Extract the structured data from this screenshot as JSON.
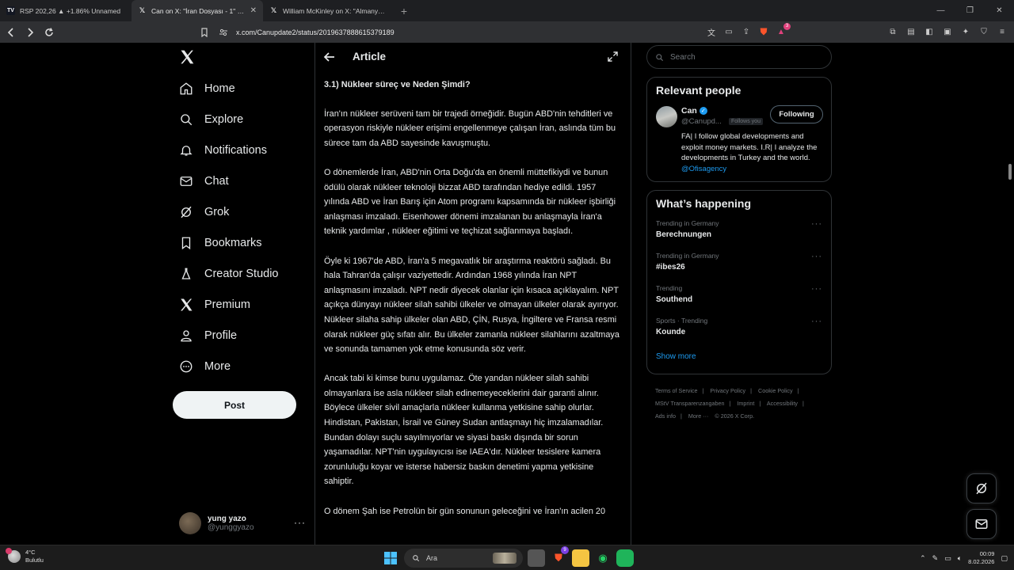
{
  "browser": {
    "tabs": [
      {
        "title": "RSP 202,26 ▲ +1.86% Unnamed",
        "favicon": "TV",
        "active": false
      },
      {
        "title": "Can on X: \"İran Dosyası - 1\" / X",
        "favicon": "X",
        "active": true
      },
      {
        "title": "William McKinley on X: \"Almanya'da",
        "favicon": "X",
        "active": false
      }
    ],
    "url": "x.com/Canupdate2/status/2019637888615379189",
    "brave_badge": "3"
  },
  "nav": {
    "items": [
      {
        "label": "Home",
        "icon": "home-icon"
      },
      {
        "label": "Explore",
        "icon": "search-icon"
      },
      {
        "label": "Notifications",
        "icon": "bell-icon"
      },
      {
        "label": "Chat",
        "icon": "mail-icon"
      },
      {
        "label": "Grok",
        "icon": "grok-icon"
      },
      {
        "label": "Bookmarks",
        "icon": "bookmark-icon"
      },
      {
        "label": "Creator Studio",
        "icon": "flask-icon"
      },
      {
        "label": "Premium",
        "icon": "x-icon"
      },
      {
        "label": "Profile",
        "icon": "person-icon"
      },
      {
        "label": "More",
        "icon": "more-circle-icon"
      }
    ],
    "post_label": "Post",
    "me": {
      "display_name": "yung yazo",
      "handle": "@yunggyazo"
    }
  },
  "article": {
    "header_title": "Article",
    "heading": "3.1) Nükleer süreç ve Neden Şimdi?",
    "paragraphs": [
      "İran'ın nükleer serüveni tam bir trajedi örneğidir. Bugün ABD'nin tehditleri ve  operasyon riskiyle  nükleer erişimi engellenmeye çalışan İran, aslında tüm bu sürece tam da ABD sayesinde kavuşmuştu.",
      "O dönemlerde İran, ABD'nin Orta Doğu'da en önemli müttefikiydi ve bunun ödülü olarak nükleer teknoloji bizzat ABD tarafından hediye edildi. 1957 yılında ABD ve İran Barış için Atom programı kapsamında bir nükleer işbirliği anlaşması imzaladı. Eisenhower dönemi imzalanan bu anlaşmayla İran'a teknik yardımlar , nükleer eğitimi ve teçhizat sağlanmaya başladı.",
      "Öyle ki 1967'de ABD, İran'a 5 megavatlık bir araştırma reaktörü sağladı. Bu hala  Tahran'da çalışır vaziyettedir. Ardından 1968 yılında İran  NPT anlaşmasını imzaladı. NPT nedir diyecek olanlar için kısaca açıklayalım. NPT açıkça dünyayı nükleer silah sahibi ülkeler ve olmayan ülkeler olarak ayırıyor. Nükleer silaha sahip ülkeler olan ABD, ÇİN, Rusya, İngiltere ve Fransa resmi olarak nükleer güç sıfatı alır. Bu ülkeler zamanla nükleer silahlarını azaltmaya ve sonunda tamamen yok etme konusunda söz verir.",
      "Ancak tabi ki kimse bunu uygulamaz. Öte yandan nükleer silah sahibi olmayanlara ise asla nükleer silah edinemeyeceklerini  dair garanti alınır. Böylece  ülkeler sivil amaçlarla nükleer kullanma yetkisine sahip olurlar. Hindistan, Pakistan, İsrail ve Güney Sudan antlaşmayı hiç imzalamadılar. Bundan dolayı suçlu sayılmıyorlar ve siyasi baskı dışında bir sorun yaşamadılar. NPT'nin uygulayıcısı ise IAEA'dır.  Nükleer tesislere kamera zorunluluğu koyar ve  isterse habersiz baskın denetimi yapma yetkisine sahiptir.",
      "O dönem Şah ise Petrolün bir gün sonunun geleceğini ve İran'ın acilen 20"
    ]
  },
  "search": {
    "placeholder": "Search"
  },
  "relevant": {
    "title": "Relevant people",
    "name": "Can",
    "handle": "@Canupd...",
    "follows_you": "Follows you",
    "follow_label": "Following",
    "bio": "FA| I follow global developments and exploit money markets. I.R| I analyze the developments in Turkey and the world.",
    "bio_link": "@Ofisagency"
  },
  "happening": {
    "title": "What’s happening",
    "trends": [
      {
        "context": "Trending in Germany",
        "topic": "Berechnungen"
      },
      {
        "context": "Trending in Germany",
        "topic": "#ibes26"
      },
      {
        "context": "Trending",
        "topic": "Southend"
      },
      {
        "context": "Sports · Trending",
        "topic": "Kounde"
      }
    ],
    "show_more": "Show more"
  },
  "footer": {
    "links": [
      "Terms of Service",
      "Privacy Policy",
      "Cookie Policy",
      "MStV Transparenzangaben",
      "Imprint",
      "Accessibility",
      "Ads info",
      "More ···"
    ],
    "copyright": "© 2026 X Corp."
  },
  "taskbar": {
    "temp": "4°C",
    "weather": "Bulutlu",
    "search": "Ara",
    "time": "00:09",
    "date": "8.02.2026",
    "brave_badge": "9"
  }
}
